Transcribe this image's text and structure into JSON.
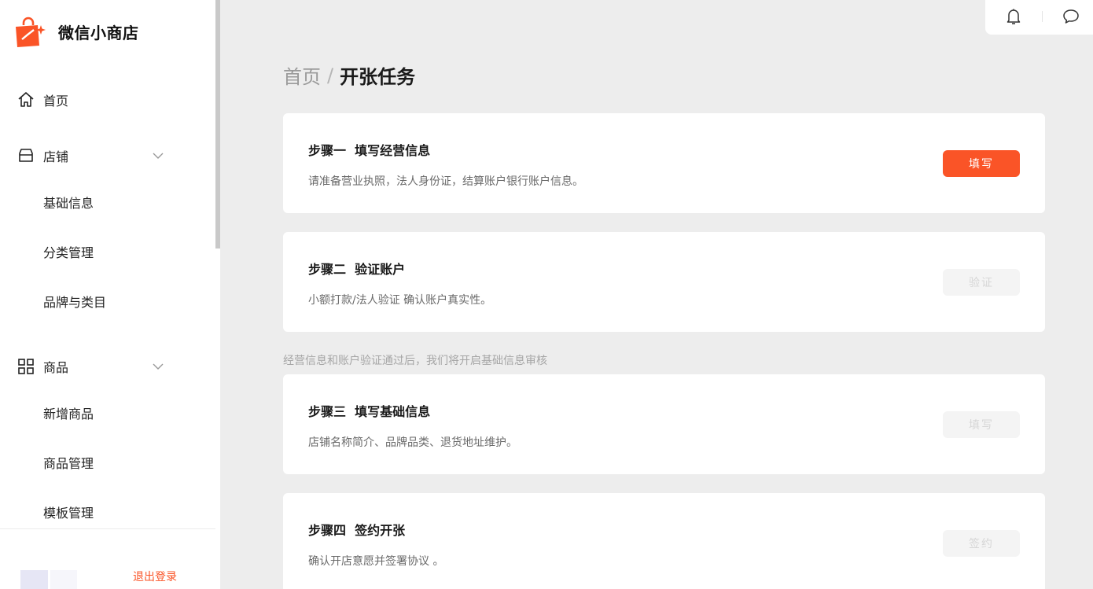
{
  "app": {
    "name": "微信小商店",
    "brand_color": "#fa5427"
  },
  "sidebar": {
    "home_label": "首页",
    "shop": {
      "label": "店铺",
      "items": [
        "基础信息",
        "分类管理",
        "品牌与类目"
      ]
    },
    "products": {
      "label": "商品",
      "items": [
        "新增商品",
        "商品管理",
        "模板管理"
      ]
    },
    "logout_label": "退出登录"
  },
  "toolbar": {
    "icons": [
      "bell-icon",
      "message-icon"
    ]
  },
  "breadcrumb": {
    "home": "首页",
    "separator": "/",
    "current": "开张任务"
  },
  "steps": [
    {
      "title": "步骤一  填写经营信息",
      "desc": "请准备营业执照，法人身份证，结算账户银行账户信息。",
      "button": "填写",
      "enabled": true
    },
    {
      "title": "步骤二  验证账户",
      "desc": "小额打款/法人验证 确认账户真实性。",
      "button": "验证",
      "enabled": false
    },
    {
      "title": "步骤三  填写基础信息",
      "desc": "店铺名称简介、品牌品类、退货地址维护。",
      "button": "填写",
      "enabled": false
    },
    {
      "title": "步骤四  签约开张",
      "desc": "确认开店意愿并签署协议 。",
      "button": "签约",
      "enabled": false
    }
  ],
  "note": "经营信息和账户验证通过后，我们将开启基础信息审核"
}
